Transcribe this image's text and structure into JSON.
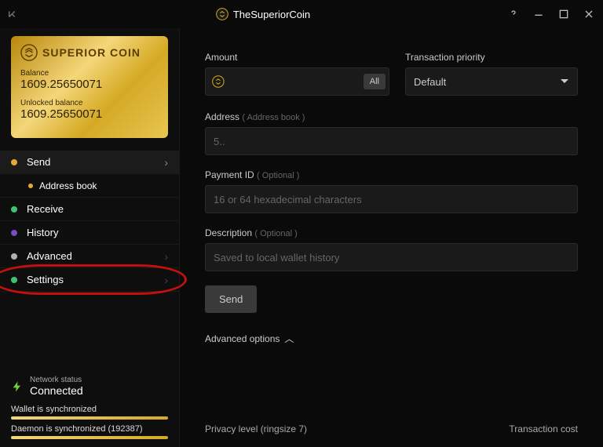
{
  "titlebar": {
    "app_name": "TheSuperiorCoin"
  },
  "balance_card": {
    "brand": "SUPERIOR COIN",
    "balance_label": "Balance",
    "balance_value": "1609.25650071",
    "unlocked_label": "Unlocked balance",
    "unlocked_value": "1609.25650071"
  },
  "nav": {
    "send": "Send",
    "address_book": "Address book",
    "receive": "Receive",
    "history": "History",
    "advanced": "Advanced",
    "settings": "Settings"
  },
  "status": {
    "label": "Network status",
    "value": "Connected",
    "wallet_sync": "Wallet is synchronized",
    "daemon_sync": "Daemon is synchronized (192387)"
  },
  "form": {
    "amount_label": "Amount",
    "all_btn": "All",
    "priority_label": "Transaction priority",
    "priority_value": "Default",
    "address_label": "Address",
    "address_hint": "( Address book )",
    "address_placeholder": "5..",
    "payment_label": "Payment ID",
    "optional_hint": "( Optional )",
    "payment_placeholder": "16 or 64 hexadecimal characters",
    "desc_label": "Description",
    "desc_placeholder": "Saved to local wallet history",
    "send_btn": "Send",
    "advanced_options": "Advanced options"
  },
  "footer": {
    "privacy": "Privacy level (ringsize 7)",
    "cost": "Transaction cost"
  }
}
